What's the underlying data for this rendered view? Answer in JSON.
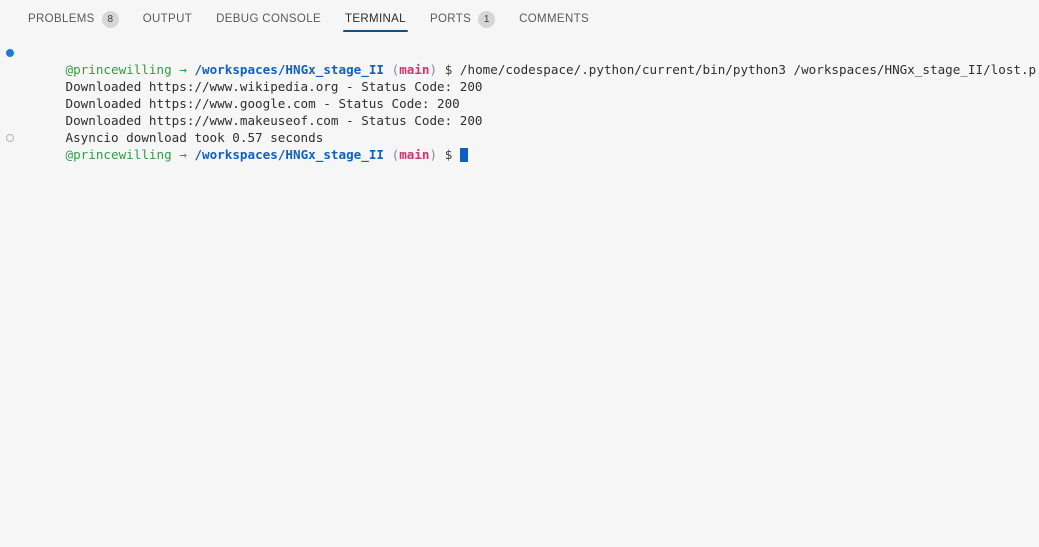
{
  "window": {
    "background_color": "#f6f6f6"
  },
  "panel": {
    "tabs": [
      {
        "label": "PROBLEMS",
        "badge": "8",
        "active": false
      },
      {
        "label": "OUTPUT",
        "badge": "",
        "active": false
      },
      {
        "label": "DEBUG CONSOLE",
        "badge": "",
        "active": false
      },
      {
        "label": "TERMINAL",
        "badge": "",
        "active": true
      },
      {
        "label": "PORTS",
        "badge": "1",
        "active": false
      },
      {
        "label": "COMMENTS",
        "badge": "",
        "active": false
      }
    ],
    "active_tab": "TERMINAL",
    "active_underline_color": "#1c4e7a",
    "badge_background_color": "#d6d6d6"
  },
  "terminal": {
    "prompt": {
      "user": "@princewilling",
      "arrow": "→",
      "path": "/workspaces/HNGx_stage_II",
      "paren_open": "(",
      "branch": "main",
      "paren_close": ")",
      "dollar": "$"
    },
    "colors": {
      "user": "#2f9e44",
      "path": "#1060c4",
      "branch": "#d6336c",
      "dollar": "#3c3c3c",
      "output": "#2f2f2f",
      "cursor": "#1060c4",
      "marker_running": "#1a7fd4",
      "marker_idle": "#b4b4b4"
    },
    "command": "/home/codespace/.python/current/bin/python3 /workspaces/HNGx_stage_II/lost.p",
    "output_lines": [
      "Downloaded https://www.wikipedia.org - Status Code: 200",
      "Downloaded https://www.google.com - Status Code: 200",
      "Downloaded https://www.makeuseof.com - Status Code: 200",
      "Asyncio download took 0.57 seconds"
    ]
  }
}
